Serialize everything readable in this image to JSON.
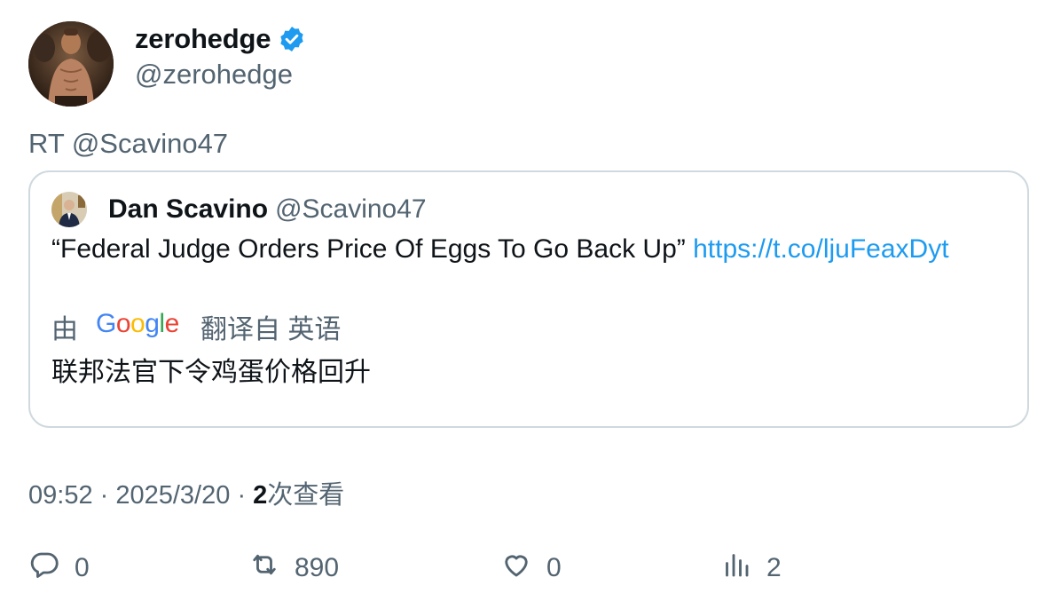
{
  "author": {
    "display_name": "zerohedge",
    "handle": "@zerohedge",
    "verified_icon": "verified-badge-icon"
  },
  "retweet_text": "RT @Scavino47",
  "quote": {
    "display_name": "Dan Scavino",
    "handle": "@Scavino47",
    "text": "“Federal Judge Orders Price Of Eggs To Go Back Up”",
    "link": "https://t.co/ljuFeaxDyt",
    "translate_prefix": "由",
    "translate_brand": "Google",
    "translate_suffix": "翻译自 英语",
    "translated_text": "联邦法官下令鸡蛋价格回升"
  },
  "meta": {
    "time": "09:52",
    "date": "2025/3/20",
    "views_count": "2",
    "views_label": "次查看"
  },
  "actions": {
    "replies": "0",
    "retweets": "890",
    "likes": "0",
    "views": "2"
  },
  "colors": {
    "text": "#0f1419",
    "secondary": "#536471",
    "link": "#1d9bf0",
    "border": "#cfd9de",
    "verified": "#1d9bf0"
  }
}
